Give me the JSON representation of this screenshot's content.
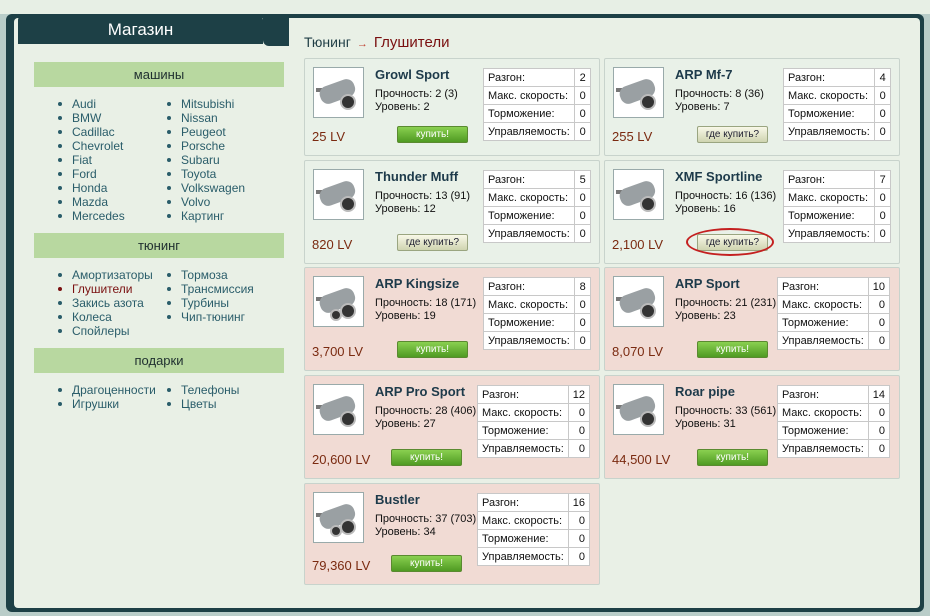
{
  "tab_title": "Магазин",
  "sidebar": {
    "sections": [
      {
        "title": "машины",
        "col1": [
          "Audi",
          "BMW",
          "Cadillac",
          "Chevrolet",
          "Fiat",
          "Ford",
          "Honda",
          "Mazda",
          "Mercedes"
        ],
        "col2": [
          "Mitsubishi",
          "Nissan",
          "Peugeot",
          "Porsche",
          "Subaru",
          "Toyota",
          "Volkswagen",
          "Volvo",
          "Картинг"
        ]
      },
      {
        "title": "тюнинг",
        "col1": [
          "Амортизаторы",
          "Глушители",
          "Закись азота",
          "Колеса",
          "Спойлеры"
        ],
        "col2": [
          "Тормоза",
          "Трансмиссия",
          "Турбины",
          "Чип-тюнинг"
        ]
      },
      {
        "title": "подарки",
        "col1": [
          "Драгоценности",
          "Игрушки"
        ],
        "col2": [
          "Телефоны",
          "Цветы"
        ]
      }
    ],
    "active_item": "Глушители"
  },
  "breadcrumb": {
    "parent": "Тюнинг",
    "arrow": "→",
    "current": "Глушители"
  },
  "stat_labels": [
    "Разгон:",
    "Макс. скорость:",
    "Торможение:",
    "Управляемость:"
  ],
  "products": [
    {
      "name": "Growl Sport",
      "durability": "Прочность: 2 (3)",
      "level": "Уровень: 2",
      "price": "25 LV",
      "button": "купить!",
      "stats": [
        "2",
        "0",
        "0",
        "0"
      ],
      "bg": "green"
    },
    {
      "name": "ARP Mf-7",
      "durability": "Прочность: 8 (36)",
      "level": "Уровень: 7",
      "price": "255 LV",
      "button": "где купить?",
      "stats": [
        "4",
        "0",
        "0",
        "0"
      ],
      "bg": "green"
    },
    {
      "name": "Thunder Muff",
      "durability": "Прочность: 13 (91)",
      "level": "Уровень: 12",
      "price": "820 LV",
      "button": "где купить?",
      "stats": [
        "5",
        "0",
        "0",
        "0"
      ],
      "bg": "green"
    },
    {
      "name": "XMF Sportline",
      "durability": "Прочность: 16 (136)",
      "level": "Уровень: 16",
      "price": "2,100 LV",
      "button": "где купить?",
      "stats": [
        "7",
        "0",
        "0",
        "0"
      ],
      "bg": "green"
    },
    {
      "name": "ARP Kingsize",
      "durability": "Прочность: 18 (171)",
      "level": "Уровень: 19",
      "price": "3,700 LV",
      "button": "купить!",
      "stats": [
        "8",
        "0",
        "0",
        "0"
      ],
      "bg": "pink"
    },
    {
      "name": "ARP Sport",
      "durability": "Прочность: 21 (231)",
      "level": "Уровень: 23",
      "price": "8,070 LV",
      "button": "купить!",
      "stats": [
        "10",
        "0",
        "0",
        "0"
      ],
      "bg": "pink"
    },
    {
      "name": "ARP Pro Sport",
      "durability": "Прочность: 28 (406)",
      "level": "Уровень: 27",
      "price": "20,600 LV",
      "button": "купить!",
      "stats": [
        "12",
        "0",
        "0",
        "0"
      ],
      "bg": "pink"
    },
    {
      "name": "Roar pipe",
      "durability": "Прочность: 33 (561)",
      "level": "Уровень: 31",
      "price": "44,500 LV",
      "button": "купить!",
      "stats": [
        "14",
        "0",
        "0",
        "0"
      ],
      "bg": "pink"
    },
    {
      "name": "Bustler",
      "durability": "Прочность: 37 (703)",
      "level": "Уровень: 34",
      "price": "79,360 LV",
      "button": "купить!",
      "stats": [
        "16",
        "0",
        "0",
        "0"
      ],
      "bg": "pink"
    }
  ]
}
